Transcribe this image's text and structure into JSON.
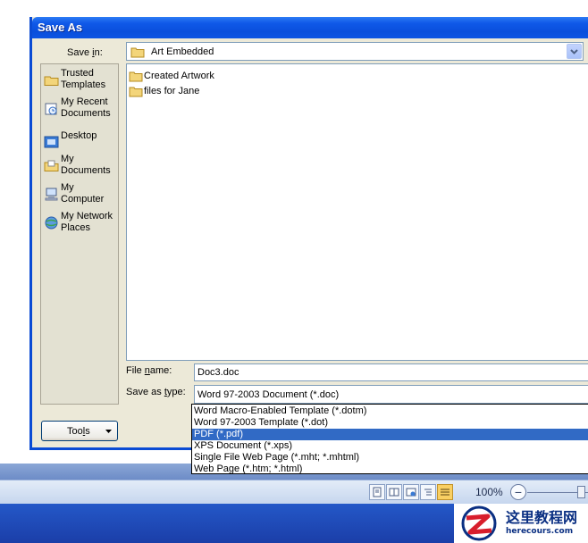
{
  "dialog": {
    "title": "Save As",
    "save_in": {
      "label_pre": "Save ",
      "label_key": "i",
      "label_post": "n:",
      "value": "Art Embedded"
    },
    "places": [
      {
        "label": "Trusted Templates",
        "icon": "trusted-templates-folder-icon"
      },
      {
        "label": "My Recent Documents",
        "icon": "recent-documents-icon"
      },
      {
        "label": "Desktop",
        "icon": "desktop-icon"
      },
      {
        "label": "My Documents",
        "icon": "my-documents-folder-icon"
      },
      {
        "label": "My Computer",
        "icon": "my-computer-icon"
      },
      {
        "label": "My Network Places",
        "icon": "network-places-icon"
      }
    ],
    "files": [
      {
        "name": "Created Artwork",
        "icon": "folder-icon"
      },
      {
        "name": "files for Jane",
        "icon": "folder-icon"
      }
    ],
    "file_name": {
      "label_pre": "File ",
      "label_key": "n",
      "label_post": "ame:",
      "value": "Doc3.doc"
    },
    "save_as_type": {
      "label_pre": "Save as ",
      "label_key": "t",
      "label_post": "ype:",
      "value": "Word 97-2003 Document (*.doc)",
      "options": [
        "Word Macro-Enabled Template (*.dotm)",
        "Word 97-2003 Template (*.dot)",
        "PDF (*.pdf)",
        "XPS Document (*.xps)",
        "Single File Web Page (*.mht; *.mhtml)",
        "Web Page (*.htm; *.html)"
      ],
      "highlighted_index": 2
    },
    "tools": {
      "label_pre": "Too",
      "label_key": "l",
      "label_post": "s"
    }
  },
  "statusbar": {
    "zoom": "100%",
    "zoom_out": "−"
  },
  "watermark": {
    "title": "这里教程网",
    "url": "herecours.com"
  },
  "colors": {
    "titlebar": "#0a4fdc",
    "dialog_bg": "#ece9d8",
    "selection": "#316ac5",
    "taskbar": "#1b3ea8"
  }
}
